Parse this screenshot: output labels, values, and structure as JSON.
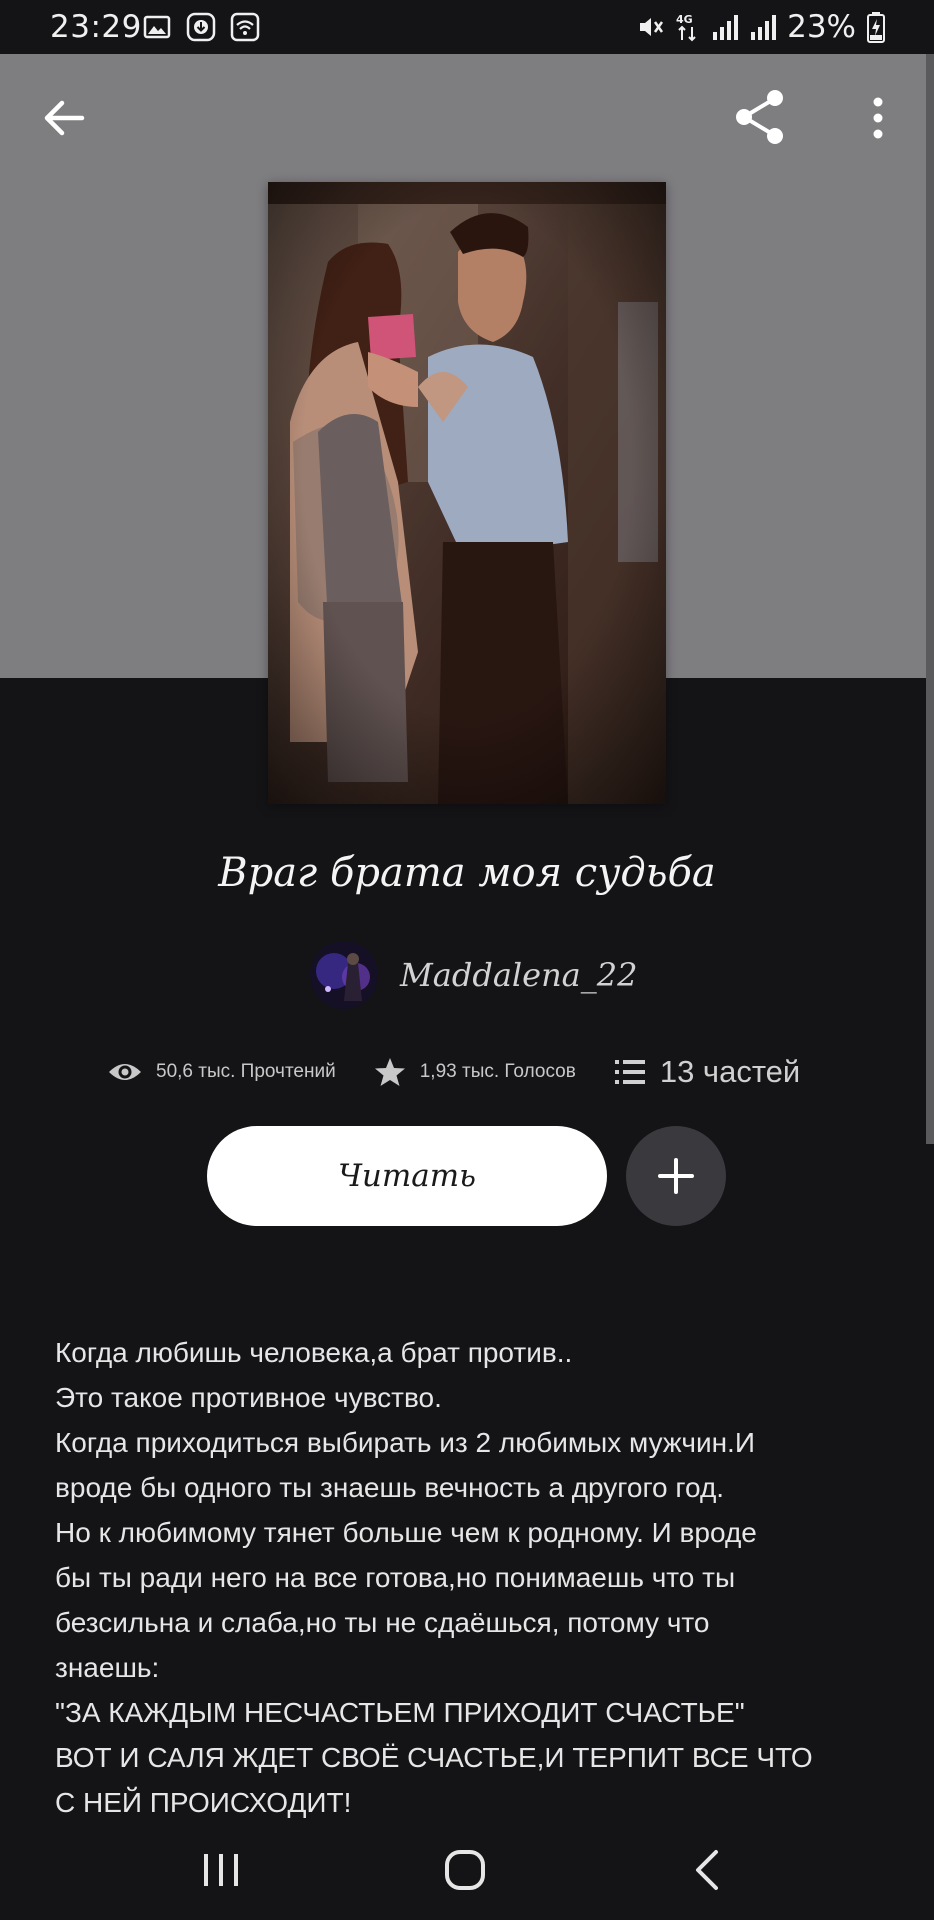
{
  "status_bar": {
    "time": "23:29",
    "left_icons": [
      "gallery-icon",
      "download-icon",
      "wifi-calling-icon"
    ],
    "right_icons": [
      "mute-icon",
      "4g-icon",
      "signal-icon",
      "signal-icon",
      "battery-charging-icon"
    ],
    "network": "4G",
    "battery": "23%"
  },
  "toolbar": {
    "back_icon": "arrow-left-icon",
    "share_icon": "share-icon",
    "more_icon": "more-vertical-icon"
  },
  "story": {
    "title": "Враг брата моя судьба",
    "author": "Maddalena_22",
    "reads": "50,6 тыс. Прочтений",
    "votes": "1,93 тыс. Голосов",
    "parts": "13 частей"
  },
  "actions": {
    "read_label": "Читать",
    "add_icon": "plus-icon"
  },
  "description": [
    "Когда любишь человека,а брат против..",
    "Это такое противное чувство.",
    "Когда приходиться выбирать из 2 любимых мужчин.И",
    "вроде бы одного ты знаешь вечность а другого год.",
    "Но к любимому тянет больше чем к родному. И вроде",
    "бы ты ради него на все готова,но понимаешь что ты",
    "безсильна и слаба,но ты не сдаёшься, потому что",
    "знаешь:",
    "\"ЗА КАЖДЫМ НЕСЧАСТЬЕМ  ПРИХОДИТ СЧАСТЬЕ\"",
    "ВОТ И САЛЯ ЖДЕТ СВОЁ СЧАСТЬЕ,И ТЕРПИТ ВСЕ ЧТО",
    "С НЕЙ ПРОИСХОДИТ!"
  ],
  "nav": {
    "recents_icon": "recent-apps-icon",
    "home_icon": "home-icon",
    "back_icon": "nav-back-icon"
  },
  "colors": {
    "header": "#7e7d80",
    "background": "#141316",
    "read_button": "#ffffff",
    "add_button": "#3a393d"
  }
}
